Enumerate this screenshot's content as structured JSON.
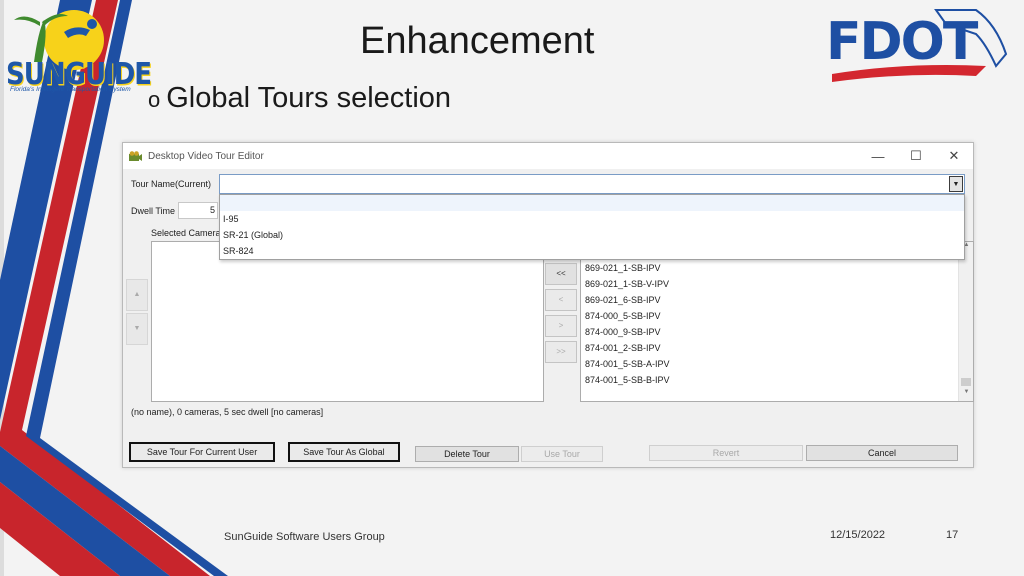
{
  "slide": {
    "title": "Enhancement",
    "bullet": "Global Tours selection",
    "bullet_marker": "o",
    "footer_left": "SunGuide Software Users Group",
    "footer_date": "12/15/2022",
    "footer_page": "17"
  },
  "logos": {
    "sunguide_text": "SUNGUIDE",
    "sunguide_tagline": "Florida's Intelligent Transportation System",
    "fdot_text": "FDOT"
  },
  "colors": {
    "stripe_blue": "#1e4fa3",
    "stripe_red": "#c8252c",
    "fdot_blue": "#1e4fa3",
    "fdot_red": "#d3272f"
  },
  "window": {
    "title": "Desktop Video Tour Editor",
    "controls": {
      "minimize": "—",
      "maximize": "☐",
      "close": "✕"
    },
    "tour_name_label": "Tour Name(Current)",
    "tour_name_value": "",
    "dwell_label": "Dwell Time",
    "dwell_value": "5",
    "selected_label": "Selected Cameras",
    "dropdown_options": [
      "",
      "I-95",
      "SR-21 (Global)",
      "SR-824"
    ],
    "selected_cameras": [],
    "available_cameras": [
      "869-021_1-SB-IPV",
      "869-021_1-SB-V-IPV",
      "869-021_6-SB-IPV",
      "874-000_5-SB-IPV",
      "874-000_9-SB-IPV",
      "874-001_2-SB-IPV",
      "874-001_5-SB-A-IPV",
      "874-001_5-SB-B-IPV"
    ],
    "transfer_buttons": {
      "add_all": "<<",
      "add": "<",
      "remove": ">",
      "remove_all": ">>"
    },
    "reorder_buttons": {
      "up": "▲",
      "down": "▼"
    },
    "status": "(no name), 0 cameras, 5 sec dwell [no cameras]",
    "buttons": {
      "save_current": "Save Tour For Current User",
      "save_global": "Save Tour As Global",
      "delete": "Delete Tour",
      "use": "Use Tour",
      "revert": "Revert",
      "cancel": "Cancel"
    }
  }
}
